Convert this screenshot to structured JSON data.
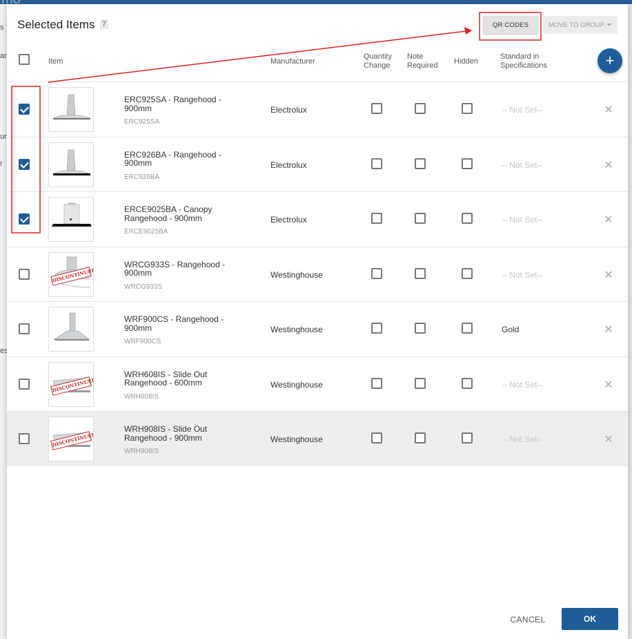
{
  "background": {
    "app_title_fragment": "mo",
    "side_fragments": [
      "s",
      "ar",
      "ur",
      "r",
      "es"
    ]
  },
  "dialog": {
    "title": "Selected Items",
    "count": "7",
    "qr_button": "QR CODES",
    "move_button": "MOVE TO GROUP",
    "add_button_icon": "plus-icon",
    "cancel_label": "CANCEL",
    "ok_label": "OK"
  },
  "columns": {
    "item": "Item",
    "manufacturer": "Manufacturer",
    "quantity_change": [
      "Quantity",
      "Change"
    ],
    "note_required": [
      "Note",
      "Required"
    ],
    "hidden": "Hidden",
    "standard": [
      "Standard in",
      "Specifications"
    ]
  },
  "rows": [
    {
      "name_l1": "ERC925SA - Rangehood -",
      "name_l2": "900mm",
      "code": "ERC925SA",
      "manufacturer": "Electrolux",
      "standard": "-- Not Set--",
      "selected": true,
      "discontinued": false,
      "image": "wall-rangehood-stainless"
    },
    {
      "name_l1": "ERC926BA - Rangehood -",
      "name_l2": "900mm",
      "code": "ERC926BA",
      "manufacturer": "Electrolux",
      "standard": "-- Not Set--",
      "selected": true,
      "discontinued": false,
      "image": "wall-rangehood-black"
    },
    {
      "name_l1": "ERCE9025BA - Canopy",
      "name_l2": "Rangehood - 900mm",
      "code": "ERCE9025BA",
      "manufacturer": "Electrolux",
      "standard": "-- Not Set--",
      "selected": true,
      "discontinued": false,
      "image": "canopy-rangehood-black"
    },
    {
      "name_l1": "WRCG933S - Rangehood -",
      "name_l2": "900mm",
      "code": "WRCG933S",
      "manufacturer": "Westinghouse",
      "standard": "-- Not Set--",
      "selected": false,
      "discontinued": true,
      "discontinued_label": "DISCONTINUED",
      "image": "curved-glass-rangehood"
    },
    {
      "name_l1": "WRF900CS - Rangehood -",
      "name_l2": "900mm",
      "code": "WRF900CS",
      "manufacturer": "Westinghouse",
      "standard": "Gold",
      "selected": false,
      "discontinued": false,
      "image": "chimney-rangehood"
    },
    {
      "name_l1": "WRH608IS - Slide Out",
      "name_l2": "Rangehood - 600mm",
      "code": "WRH608IS",
      "manufacturer": "Westinghouse",
      "standard": "-- Not Set--",
      "selected": false,
      "discontinued": true,
      "discontinued_label": "DISCONTINUED",
      "image": "slideout-rangehood"
    },
    {
      "name_l1": "WRH908IS - Slide Out",
      "name_l2": "Rangehood - 900mm",
      "code": "WRH908IS",
      "manufacturer": "Westinghouse",
      "standard": "-- Not Set--",
      "selected": false,
      "discontinued": true,
      "discontinued_label": "DISCONTINUED",
      "image": "slideout-rangehood",
      "highlighted": true
    }
  ],
  "annotation_color": "#e02020",
  "accent_color": "#1f5d99"
}
